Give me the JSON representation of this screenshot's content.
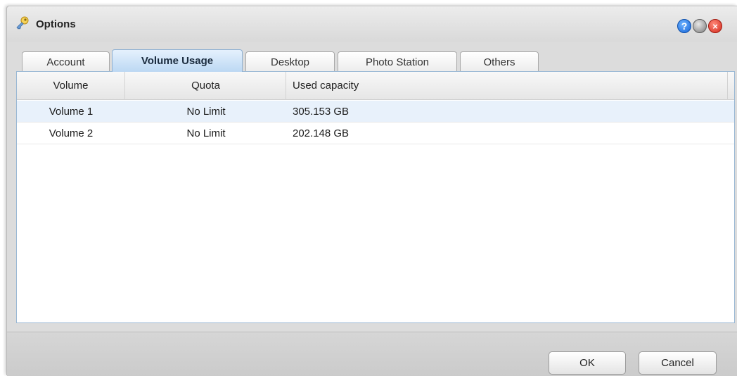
{
  "window": {
    "title": "Options",
    "help_symbol": "?",
    "close_symbol": "×"
  },
  "tabs": [
    {
      "label": "Account",
      "active": false
    },
    {
      "label": "Volume Usage",
      "active": true
    },
    {
      "label": "Desktop",
      "active": false
    },
    {
      "label": "Photo Station",
      "active": false
    },
    {
      "label": "Others",
      "active": false
    }
  ],
  "table": {
    "columns": [
      "Volume",
      "Quota",
      "Used capacity"
    ],
    "rows": [
      {
        "volume": "Volume 1",
        "quota": "No Limit",
        "used": "305.153 GB",
        "selected": true
      },
      {
        "volume": "Volume 2",
        "quota": "No Limit",
        "used": "202.148 GB",
        "selected": false
      }
    ]
  },
  "footer": {
    "ok_label": "OK",
    "cancel_label": "Cancel"
  },
  "colors": {
    "active_tab": "#bcd8f3",
    "selected_row": "#e8f1fb",
    "help_button": "#1564d8",
    "close_button": "#d2281b"
  },
  "icons": {
    "title": "options-key-icon",
    "help": "help-icon",
    "minimize": "minimize-icon",
    "close": "close-icon"
  }
}
